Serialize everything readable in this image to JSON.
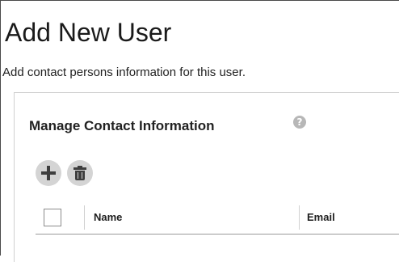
{
  "page": {
    "title": "Add New User",
    "subtitle": "Add contact persons information for this user."
  },
  "contact_panel": {
    "title": "Manage Contact Information",
    "help_icon": "help-icon",
    "toolbar": {
      "add_icon": "plus-icon",
      "delete_icon": "trash-icon"
    },
    "table": {
      "columns": [
        "Name",
        "Email"
      ],
      "select_all_checked": false
    }
  },
  "colors": {
    "icon_button_bg": "#d4d4d4",
    "icon_glyph": "#3e3e3e",
    "help_icon_bg": "#b7b7b7"
  }
}
